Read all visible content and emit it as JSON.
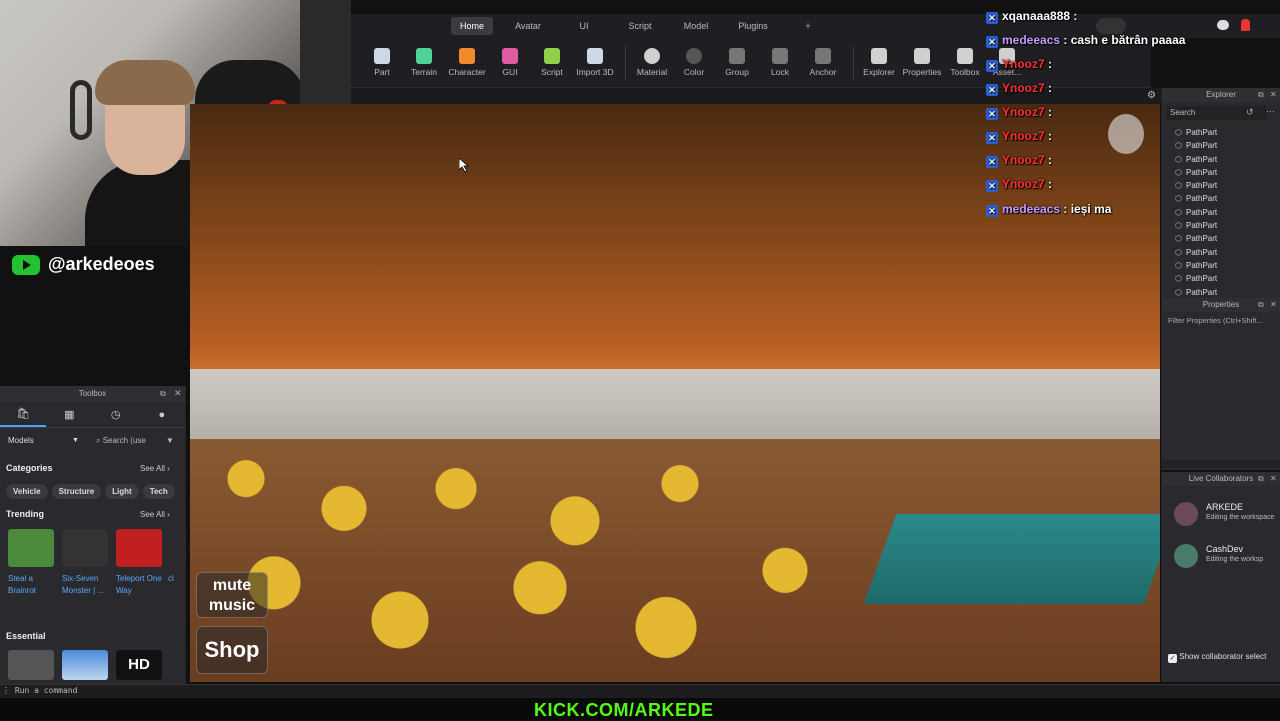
{
  "menubar": {
    "tabs": [
      {
        "label": "Home",
        "active": true
      },
      {
        "label": "Avatar"
      },
      {
        "label": "UI"
      },
      {
        "label": "Script"
      },
      {
        "label": "Model"
      },
      {
        "label": "Plugins"
      },
      {
        "label": "+"
      }
    ]
  },
  "ribbon": {
    "tools": [
      {
        "label": "Part",
        "icon": "part-icon",
        "color": "#cfd8e8"
      },
      {
        "label": "Terrain",
        "icon": "terrain-icon",
        "color": "#4fd19a"
      },
      {
        "label": "Character",
        "icon": "character-icon",
        "color": "#f08a2a"
      },
      {
        "label": "GUI",
        "icon": "gui-icon",
        "color": "#e05aa0"
      },
      {
        "label": "Script",
        "icon": "script-icon",
        "color": "#8fd14a"
      },
      {
        "label": "Import 3D",
        "icon": "import-3d-icon",
        "color": "#cfd8e8"
      },
      {
        "label": "Material",
        "icon": "material-icon",
        "color": "#d0d0d0"
      },
      {
        "label": "Color",
        "icon": "color-icon",
        "color": "#555"
      },
      {
        "label": "Group",
        "icon": "group-icon",
        "color": "#777"
      },
      {
        "label": "Lock",
        "icon": "lock-icon",
        "color": "#777"
      },
      {
        "label": "Anchor",
        "icon": "anchor-icon",
        "color": "#777"
      },
      {
        "label": "Explorer",
        "icon": "explorer-icon",
        "color": "#d0d0d0"
      },
      {
        "label": "Properties",
        "icon": "properties-icon",
        "color": "#d0d0d0"
      },
      {
        "label": "Toolbox",
        "icon": "toolbox-icon",
        "color": "#d0d0d0"
      },
      {
        "label": "Asset...",
        "icon": "asset-icon",
        "color": "#d0d0d0"
      }
    ]
  },
  "stream": {
    "handle": "@arkedeoes",
    "youtube_color": "#22c232",
    "kick_banner": "KICK.COM/ARKEDE",
    "kick_color": "#53fc18"
  },
  "viewport": {
    "mute_label": "mute music",
    "shop_label": "Shop"
  },
  "chat": [
    {
      "user": "xqanaaa888",
      "msg": "",
      "color": "#ffffff"
    },
    {
      "user": "medeeacs",
      "msg": "cash e bătrân paaaa",
      "color": "#c59aff"
    },
    {
      "user": "Ynooz7",
      "msg": "",
      "color": "#ff3030"
    },
    {
      "user": "Ynooz7",
      "msg": "",
      "color": "#ff3030"
    },
    {
      "user": "Ynooz7",
      "msg": "",
      "color": "#ff3030"
    },
    {
      "user": "Ynooz7",
      "msg": "",
      "color": "#ff3030"
    },
    {
      "user": "Ynooz7",
      "msg": "",
      "color": "#ff3030"
    },
    {
      "user": "Ynooz7",
      "msg": "",
      "color": "#ff3030"
    },
    {
      "user": "medeeacs",
      "msg": "ieși ma",
      "color": "#c59aff"
    }
  ],
  "toolbox": {
    "title": "Toolbox",
    "category_select": "Models",
    "search_placeholder": "Search (use",
    "categories_title": "Categories",
    "see_all": "See All",
    "categories": [
      "Vehicle",
      "Structure",
      "Light",
      "Tech"
    ],
    "trending_title": "Trending",
    "trending": [
      {
        "name": "Steal a Brainrot",
        "color": "#4a8a3a"
      },
      {
        "name": "Six-Seven Monster | ...",
        "color": "#333"
      },
      {
        "name": "Teleport One Way",
        "color": "#c02020"
      },
      {
        "name": "cl",
        "color": "#2a2a2e"
      }
    ],
    "essential_title": "Essential",
    "essential_hd": "HD"
  },
  "explorer": {
    "title": "Explorer",
    "search_placeholder": "Search",
    "items": [
      "PathPart",
      "PathPart",
      "PathPart",
      "PathPart",
      "PathPart",
      "PathPart",
      "PathPart",
      "PathPart",
      "PathPart",
      "PathPart",
      "PathPart",
      "PathPart",
      "PathPart"
    ]
  },
  "properties": {
    "title": "Properties",
    "filter_placeholder": "Filter Properties (Ctrl+Shift..."
  },
  "live_collab": {
    "title": "Live Collaborators",
    "users": [
      {
        "name": "ARKEDE",
        "status": "Editing the workspace",
        "color": "#6a4a5a"
      },
      {
        "name": "CashDev",
        "status": "Editing the worksp",
        "color": "#4a7a6a"
      }
    ],
    "show_selection_label": "Show collaborator select"
  },
  "command_bar": {
    "placeholder": "Run a command"
  }
}
